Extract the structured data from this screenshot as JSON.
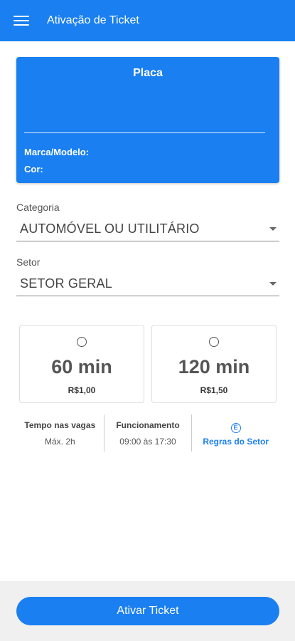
{
  "header": {
    "title": "Ativação de Ticket",
    "menu_icon": "hamburger-menu-icon"
  },
  "colors": {
    "primary": "#1a7ff0",
    "footer_bg": "#f0f0f0"
  },
  "plate_card": {
    "title": "Placa",
    "brand_model_label": "Marca/Modelo:",
    "color_label": "Cor:"
  },
  "category": {
    "label": "Categoria",
    "value": "AUTOMÓVEL OU UTILITÁRIO"
  },
  "sector": {
    "label": "Setor",
    "value": "SETOR GERAL"
  },
  "options": [
    {
      "duration": "60 min",
      "price": "R$1,00",
      "selected": false
    },
    {
      "duration": "120 min",
      "price": "R$1,50",
      "selected": false
    }
  ],
  "info": {
    "parking_time_label": "Tempo nas vagas",
    "parking_time_value": "Máx. 2h",
    "hours_label": "Funcionamento",
    "hours_value": "09:00 às 17:30",
    "rules_icon_glyph": "E",
    "rules_link": "Regras do Setor"
  },
  "footer": {
    "activate_label": "Ativar Ticket"
  }
}
